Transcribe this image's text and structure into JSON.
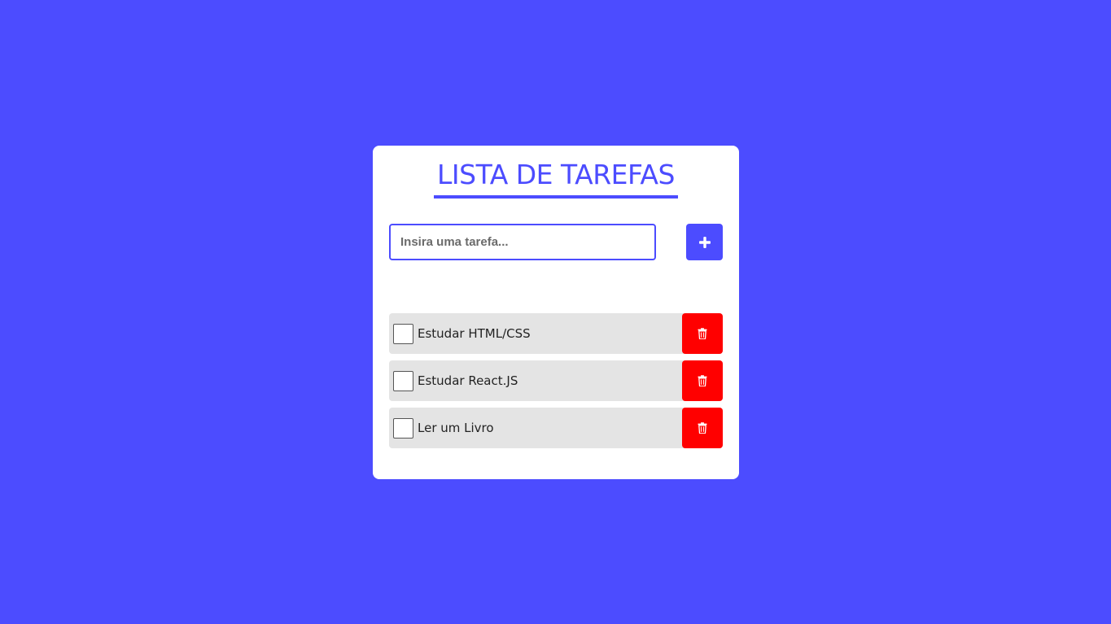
{
  "header": {
    "title": "LISTA DE TAREFAS"
  },
  "form": {
    "input_placeholder": "Insira uma tarefa...",
    "input_value": "",
    "add_icon": "plus-icon"
  },
  "tasks": [
    {
      "label": "Estudar HTML/CSS",
      "done": false
    },
    {
      "label": "Estudar React.JS",
      "done": false
    },
    {
      "label": "Ler um Livro",
      "done": false
    }
  ],
  "colors": {
    "background": "#4c4cff",
    "accent": "#4c4cff",
    "card": "#ffffff",
    "task_row": "#e4e4e4",
    "delete": "#ff0000"
  },
  "icons": {
    "delete": "trash-icon"
  }
}
